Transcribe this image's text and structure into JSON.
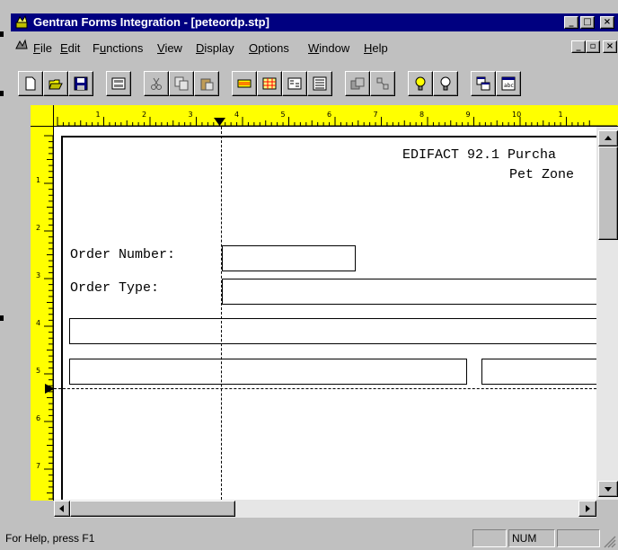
{
  "window": {
    "title": "Gentran Forms Integration - [peteordp.stp]",
    "app_icon": "gentran-app-icon",
    "caption_buttons": [
      "minimize",
      "maximize",
      "close"
    ]
  },
  "menubar": {
    "items": [
      {
        "label": "File",
        "key": "F"
      },
      {
        "label": "Edit",
        "key": "E"
      },
      {
        "label": "Functions",
        "key": "u"
      },
      {
        "label": "View",
        "key": "V"
      },
      {
        "label": "Display",
        "key": "D"
      },
      {
        "label": "Options",
        "key": "O"
      },
      {
        "label": "Window",
        "key": "W"
      },
      {
        "label": "Help",
        "key": "H"
      }
    ],
    "mdi_buttons": [
      "minimize",
      "restore",
      "close"
    ]
  },
  "toolbar": {
    "buttons": [
      "new-icon",
      "open-icon",
      "save-icon",
      "layout-icon",
      "cut-icon",
      "copy-icon",
      "paste-icon",
      "field-icon",
      "grid-icon",
      "sort-icon",
      "list-icon",
      "group-icon",
      "link-icon",
      "bulb-on-icon",
      "bulb-off-icon",
      "windows-icon",
      "label-icon"
    ]
  },
  "ruler": {
    "h_numbers": [
      "1",
      "2",
      "3",
      "4",
      "5",
      "6",
      "7",
      "8",
      "9",
      "10",
      "1"
    ],
    "v_numbers": [
      "1",
      "2",
      "3",
      "4",
      "5",
      "6",
      "7"
    ]
  },
  "form": {
    "heading_line1": "EDIFACT 92.1 Purcha",
    "heading_line2": "Pet Zone",
    "order_number_label": "Order Number:",
    "order_type_label": "Order Type:"
  },
  "statusbar": {
    "help_text": "For Help, press F1",
    "num_indicator": "NUM"
  },
  "colors": {
    "titlebar": "#000080",
    "ruler": "#ffff00",
    "face": "#c0c0c0"
  }
}
